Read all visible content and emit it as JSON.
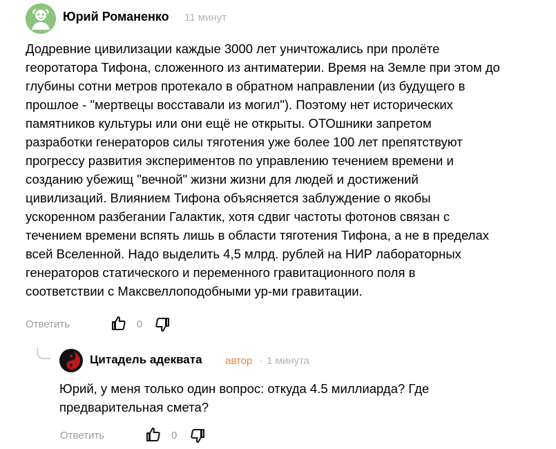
{
  "comment": {
    "author": "Юрий Романенко",
    "time": "11 минут",
    "text": "Додревние цивилизации каждые 3000 лет уничтожались при пролёте\nгеоротатора Тифона, сложенного из антиматерии. Время на Земле при этом до\nглубины сотни метров протекало в обратном направлении (из будущего в\nпрошлое - \"мертвецы восставали из могил\"). Поэтому нет исторических\nпамятников культуры или они ещё не открыты. ОТОшники запретом\nразработки генераторов силы тяготения уже более 100 лет препятствуют\nпрогрессу развития экспериментов по управлению течением времени и\nсозданию убежищ \"вечной\" жизни жизни для людей и достижений\nцивилизаций. Влиянием Тифона объясняется заблуждение о якобы\nускоренном разбегании Галактик, хотя сдвиг частоты фотонов связан с\nтечением времени вспять лишь в области тяготения Тифона, а не в пределах\nвсей Вселенной. Надо выделить 4,5 млрд. рублей на НИР лабораторных\nгенераторов статического и переменного гравитационного поля в\nсоответствии с Максвеллоподобными ур-ми гравитации.",
    "reply_label": "Ответить",
    "rating": "0",
    "avatar_color": "#8bc37f",
    "like_icon": "thumbs-up-icon",
    "dislike_icon": "thumbs-down-icon"
  },
  "reply": {
    "author": "Цитадель адеквата",
    "badge": "автор",
    "separator": "·",
    "time": "1 минута",
    "text": "Юрий, у меня только один вопрос: откуда 4.5 миллиарда? Где\nпредварительная смета?",
    "reply_label": "Ответить",
    "rating": "0",
    "badge_color": "#e8823a",
    "like_icon": "thumbs-up-icon",
    "dislike_icon": "thumbs-down-icon"
  }
}
